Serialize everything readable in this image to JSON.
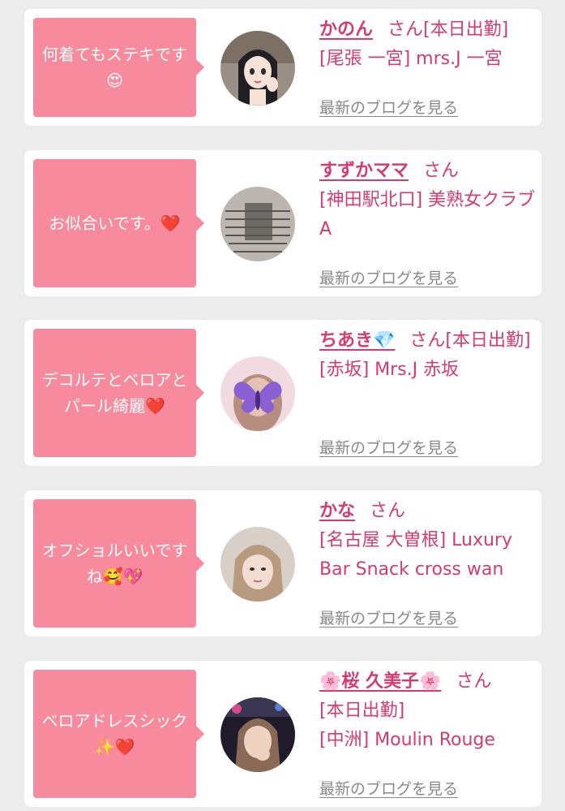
{
  "colors": {
    "accent": "#f78a9c",
    "name": "#d63b6f",
    "link": "#888888",
    "background": "#ececec"
  },
  "blog_link": "最新のブログを見る",
  "cards": [
    {
      "comment": "何着てもステキです😍",
      "name": "かのん",
      "suffix": "さん",
      "status": "[本日出勤]",
      "location": "[尾張 一宮] mrs.J 一宮",
      "avatar_icon": "anime-girl-avatar"
    },
    {
      "comment": "お似合いです。❤️",
      "name": "すずかママ",
      "suffix": "さん",
      "status": "",
      "location": "[神田駅北口] 美熟女クラブA",
      "avatar_icon": "notice-board-avatar"
    },
    {
      "comment": "デコルテとベロアとパール綺麗❤️",
      "name": "ちあき💎",
      "suffix": "さん",
      "status": "[本日出勤]",
      "location": "[赤坂] Mrs.J 赤坂",
      "avatar_icon": "butterfly-avatar"
    },
    {
      "comment": "オフショルいいですね🥰💖",
      "name": "かな",
      "suffix": "さん",
      "status": "",
      "location": "[名古屋 大曽根] Luxury Bar Snack cross wan",
      "avatar_icon": "woman-photo-avatar"
    },
    {
      "comment": "ベロアドレスシック✨❤️",
      "name": "🌸桜 久美子🌸",
      "suffix": "さん",
      "status": "[本日出勤]",
      "location": "[中洲] Moulin Rouge",
      "avatar_icon": "night-photo-avatar"
    }
  ]
}
